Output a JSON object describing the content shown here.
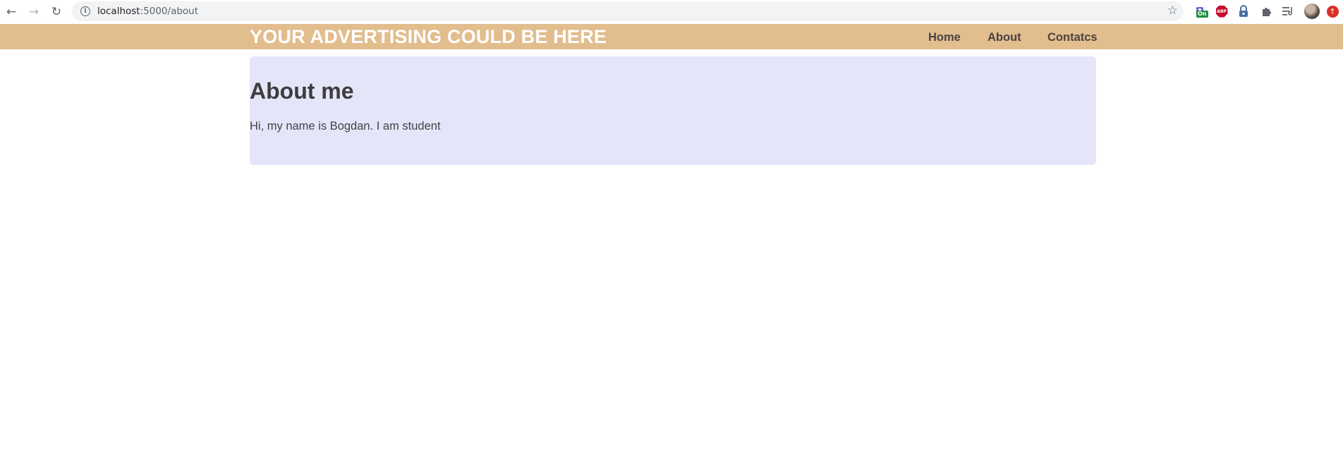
{
  "browser": {
    "url_host": "localhost",
    "url_path": ":5000/about",
    "ext_badge": "On",
    "abp_label": "ABP",
    "icons": [
      "back-icon",
      "forward-icon",
      "reload-icon",
      "info-icon",
      "star-icon",
      "extensions-puzzle-icon",
      "reading-list-icon"
    ]
  },
  "header": {
    "title": "YOUR ADVERTISING COULD BE HERE",
    "nav": [
      {
        "label": "Home"
      },
      {
        "label": "About"
      },
      {
        "label": "Contatcs"
      }
    ],
    "bg_color": "#e2bd8e"
  },
  "main": {
    "heading": "About me",
    "text": "Hi, my name is Bogdan. I am student",
    "bg_color": "#e4e5f9"
  }
}
